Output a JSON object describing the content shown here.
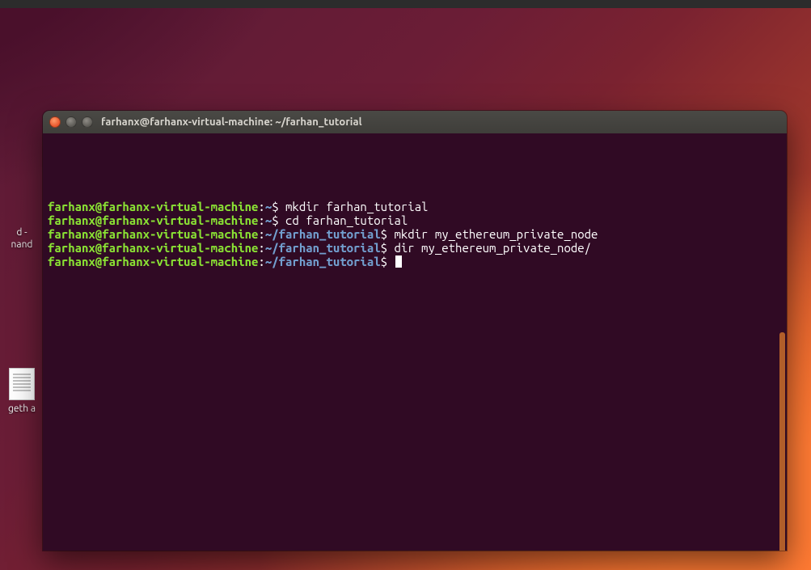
{
  "desktop": {
    "icons": [
      {
        "label": "d -\nnand"
      },
      {
        "label": "geth a"
      }
    ]
  },
  "window": {
    "title": "farhanx@farhanx-virtual-machine: ~/farhan_tutorial"
  },
  "terminal": {
    "lines": [
      {
        "user_host": "farhanx@farhanx-virtual-machine",
        "cwd": "~",
        "cmd": "mkdir farhan_tutorial"
      },
      {
        "user_host": "farhanx@farhanx-virtual-machine",
        "cwd": "~",
        "cmd": "cd farhan_tutorial"
      },
      {
        "user_host": "farhanx@farhanx-virtual-machine",
        "cwd": "~/farhan_tutorial",
        "cmd": "mkdir my_ethereum_private_node"
      },
      {
        "user_host": "farhanx@farhanx-virtual-machine",
        "cwd": "~/farhan_tutorial",
        "cmd": "dir my_ethereum_private_node/"
      },
      {
        "user_host": "farhanx@farhanx-virtual-machine",
        "cwd": "~/farhan_tutorial",
        "cmd": ""
      }
    ]
  }
}
